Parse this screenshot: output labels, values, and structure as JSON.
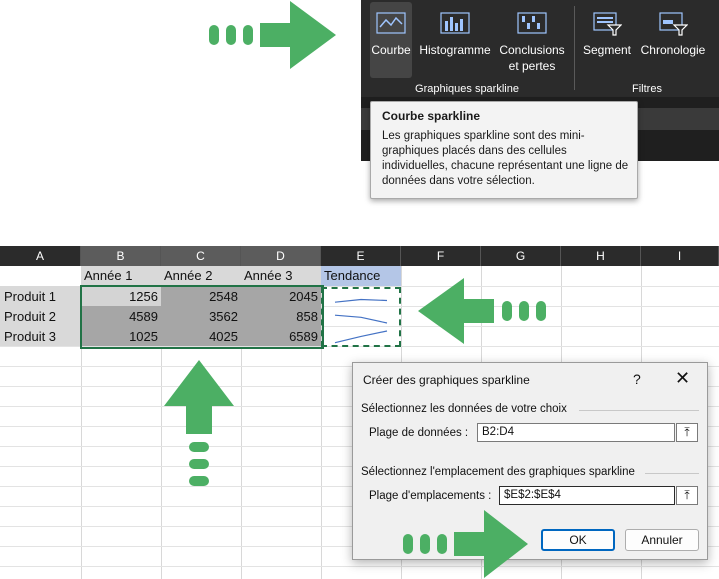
{
  "ribbon": {
    "buttons": [
      {
        "label": "Courbe",
        "icon": "line-sparkline-icon"
      },
      {
        "label": "Histogramme",
        "icon": "column-sparkline-icon"
      },
      {
        "label": "Conclusions\net pertes",
        "icon": "win-loss-sparkline-icon"
      },
      {
        "label": "Segment",
        "icon": "slicer-icon"
      },
      {
        "label": "Chronologie",
        "icon": "timeline-icon"
      }
    ],
    "groups": {
      "sparklines": "Graphiques sparkline",
      "filters": "Filtres"
    }
  },
  "tooltip": {
    "title": "Courbe sparkline",
    "body": "Les graphiques sparkline sont des mini-graphiques placés dans des cellules individuelles, chacune représentant une ligne de données dans votre sélection."
  },
  "sheet": {
    "columns": [
      "A",
      "B",
      "C",
      "D",
      "E",
      "F",
      "G",
      "H",
      "I"
    ],
    "headers": [
      "Année 1",
      "Année 2",
      "Année 3",
      "Tendance"
    ],
    "rows": [
      {
        "label": "Produit 1",
        "values": [
          1256,
          2548,
          2045
        ]
      },
      {
        "label": "Produit 2",
        "values": [
          4589,
          3562,
          858
        ]
      },
      {
        "label": "Produit 3",
        "values": [
          1025,
          4025,
          6589
        ]
      }
    ]
  },
  "dialog": {
    "title": "Créer des graphiques sparkline",
    "help": "?",
    "close": "✕",
    "section1": "Sélectionnez les données de votre choix",
    "data_range_label": "Plage de données :",
    "data_range_value": "B2:D4",
    "section2": "Sélectionnez l'emplacement des graphiques sparkline",
    "location_label": "Plage d'emplacements :",
    "location_value": "$E$2:$E$4",
    "ok": "OK",
    "cancel": "Annuler"
  },
  "colors": {
    "ribbon_bg": "#2b2b2b",
    "selection_fill": "#a6a6a6",
    "header_fill": "#d9d9d9",
    "sparkline": "#4472c4",
    "arrow": "#4caf64",
    "ok_border": "#0067c0"
  }
}
